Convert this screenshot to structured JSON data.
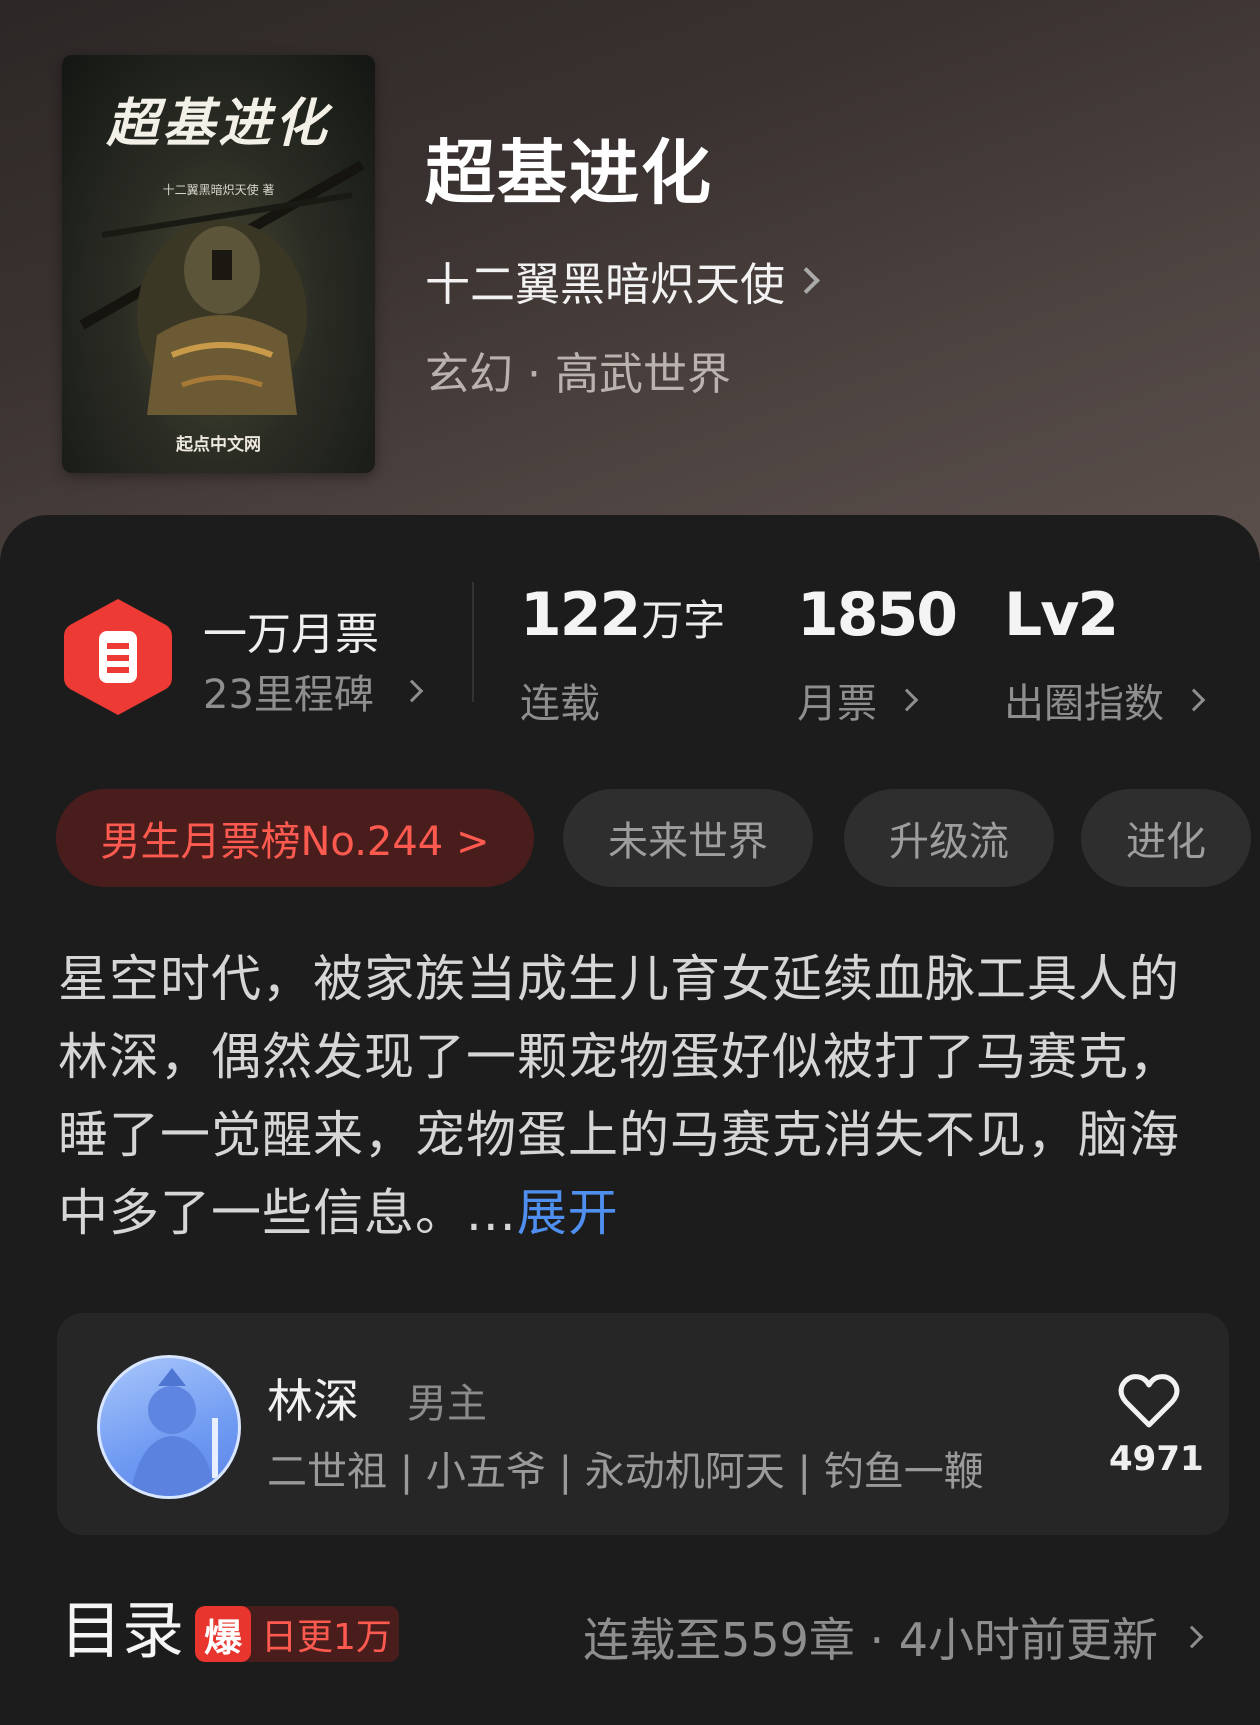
{
  "book": {
    "title": "超基进化",
    "author": "十二翼黑暗炽天使",
    "genre": "玄幻 · 高武世界",
    "cover": {
      "title": "超基进化",
      "author_line": "十二翼黑暗炽天使 著",
      "site": "起点中文网"
    }
  },
  "stats": {
    "milestone": {
      "title": "一万月票",
      "subtitle": "23里程碑"
    },
    "words": {
      "value": "122",
      "unit": "万字",
      "label": "连载"
    },
    "monthly_tickets": {
      "value": "1850",
      "label": "月票"
    },
    "influence": {
      "value": "Lv2",
      "label": "出圈指数"
    }
  },
  "tags": [
    "男生月票榜No.244 >",
    "未来世界",
    "升级流",
    "进化"
  ],
  "description": {
    "text": "星空时代，被家族当成生儿育女延续血脉工具人的林深，偶然发现了一颗宠物蛋好似被打了马赛克，睡了一觉醒来，宠物蛋上的马赛克消失不见，脑海中多了一些信息。...",
    "expand_label": "展开"
  },
  "character": {
    "name": "林深",
    "role": "男主",
    "tags": "二世祖 | 小五爷 | 永动机阿天 | 钓鱼一鞭",
    "likes": "4971",
    "icon": "heart-icon"
  },
  "catalog": {
    "title": "目录",
    "badge_icon_text": "爆",
    "badge_text": "日更1万",
    "update_text": "连载至559章 · 4小时前更新"
  },
  "colors": {
    "panel_bg": "#1c1c1c",
    "accent_red": "#ff5a4f",
    "link_blue": "#4f8ff0",
    "milestone_red": "#e8362f"
  }
}
